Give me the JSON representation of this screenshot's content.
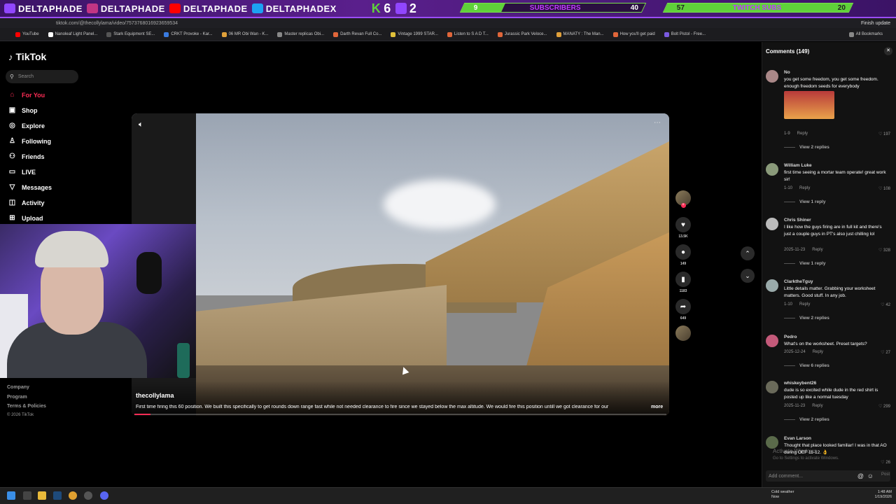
{
  "overlay": {
    "socials": [
      "DELTAPHADE",
      "DELTAPHADE",
      "DELTAPHADE",
      "DELTAPHADEX"
    ],
    "k_count": "6",
    "t_count": "2",
    "subscribers_goal": {
      "label": "SUBSCRIBERS",
      "current": "9",
      "target": "40",
      "progress": 0.225
    },
    "twitch_goal": {
      "label": "TWITCH SUBS",
      "current": "57",
      "target": "20",
      "progress": 1.0
    }
  },
  "browser": {
    "url": "tiktok.com/@thecollylama/video/7573768016923659534",
    "finish_update": "Finish update",
    "bookmarks": [
      "YouTube",
      "Nanoleaf Light Panel...",
      "Stark Equipment SE...",
      "CRKT Provoke - Kar...",
      "06 MR Obi Wan - K...",
      "Master replicas Obi...",
      "Darth Revan Full Co...",
      "Vintage 1999 STAR...",
      "Listen to S A D T...",
      "Jurassic Park Veloce...",
      "MANATY : The Man...",
      "How you'll get paid",
      "Bolt Pistol - Free..."
    ],
    "all_bookmarks": "All Bookmarks"
  },
  "tiktok": {
    "logo": "TikTok",
    "search_placeholder": "Search",
    "nav": [
      {
        "label": "For You",
        "icon": "home-icon",
        "active": true
      },
      {
        "label": "Shop",
        "icon": "shop-icon"
      },
      {
        "label": "Explore",
        "icon": "compass-icon"
      },
      {
        "label": "Following",
        "icon": "following-icon"
      },
      {
        "label": "Friends",
        "icon": "friends-icon"
      },
      {
        "label": "LIVE",
        "icon": "live-icon"
      },
      {
        "label": "Messages",
        "icon": "messages-icon"
      },
      {
        "label": "Activity",
        "icon": "activity-icon"
      },
      {
        "label": "Upload",
        "icon": "upload-icon"
      }
    ],
    "footer": [
      "Company",
      "Program",
      "Terms & Policies",
      "© 2026 TikTok"
    ],
    "video": {
      "author": "thecollylama",
      "caption": "First time firing this 60 position. We built this specifically to get rounds down range fast while not needed clearance to fire since we stayed below the max altitude. We would fire this position untill we got clearance for our",
      "more": "more",
      "progress": 0.03
    },
    "actions": {
      "likes": "13.5K",
      "comments": "149",
      "saves": "1183",
      "shares": "649"
    },
    "comments_panel": {
      "title": "Comments (149)",
      "add_placeholder": "Add comment...",
      "post": "Post",
      "items": [
        {
          "name": "No",
          "text": "you get some freedom, you get some freedom. enough freedom seeds for everybody",
          "date": "1-9",
          "reply": "Reply",
          "likes": "197",
          "replies": "View 2 replies"
        },
        {
          "name": "William Luke",
          "text": "first time seeing a mortar team operate! great work sir!",
          "date": "1-10",
          "reply": "Reply",
          "likes": "108",
          "replies": "View 1 reply"
        },
        {
          "name": "Chris Shiner",
          "text": "I like how the guys firing are in full kit and there's just a couple guys in PT's also just chilling lol",
          "date": "2025-11-23",
          "reply": "Reply",
          "likes": "328",
          "replies": "View 1 reply"
        },
        {
          "name": "ClarktheTguy",
          "text": "Little details matter. Grabbing your worksheet matters. Good stuff. In any job.",
          "date": "1-10",
          "reply": "Reply",
          "likes": "42",
          "replies": "View 2 replies"
        },
        {
          "name": "Pedro",
          "text": "What's on the worksheet. Preset targets?",
          "date": "2025-12-24",
          "reply": "Reply",
          "likes": "27",
          "replies": "View 6 replies"
        },
        {
          "name": "whiskeybent26",
          "text": "dude is so excited while dude in the red shirt is posted up like a normal tuesday",
          "date": "2025-11-23",
          "reply": "Reply",
          "likes": "299",
          "replies": "View 2 replies"
        },
        {
          "name": "Evan Larson",
          "text": "Thought that place looked familiar! I was in that AO during OEF 11-12. 👌",
          "date": "",
          "reply": "",
          "likes": "26",
          "replies": ""
        }
      ]
    }
  },
  "windows": {
    "activate_title": "Activate Windows",
    "activate_sub": "Go to Settings to activate Windows.",
    "weather": "Cold weather",
    "weather_sub": "Now",
    "time": "1:48 AM",
    "date": "1/19/2026"
  }
}
